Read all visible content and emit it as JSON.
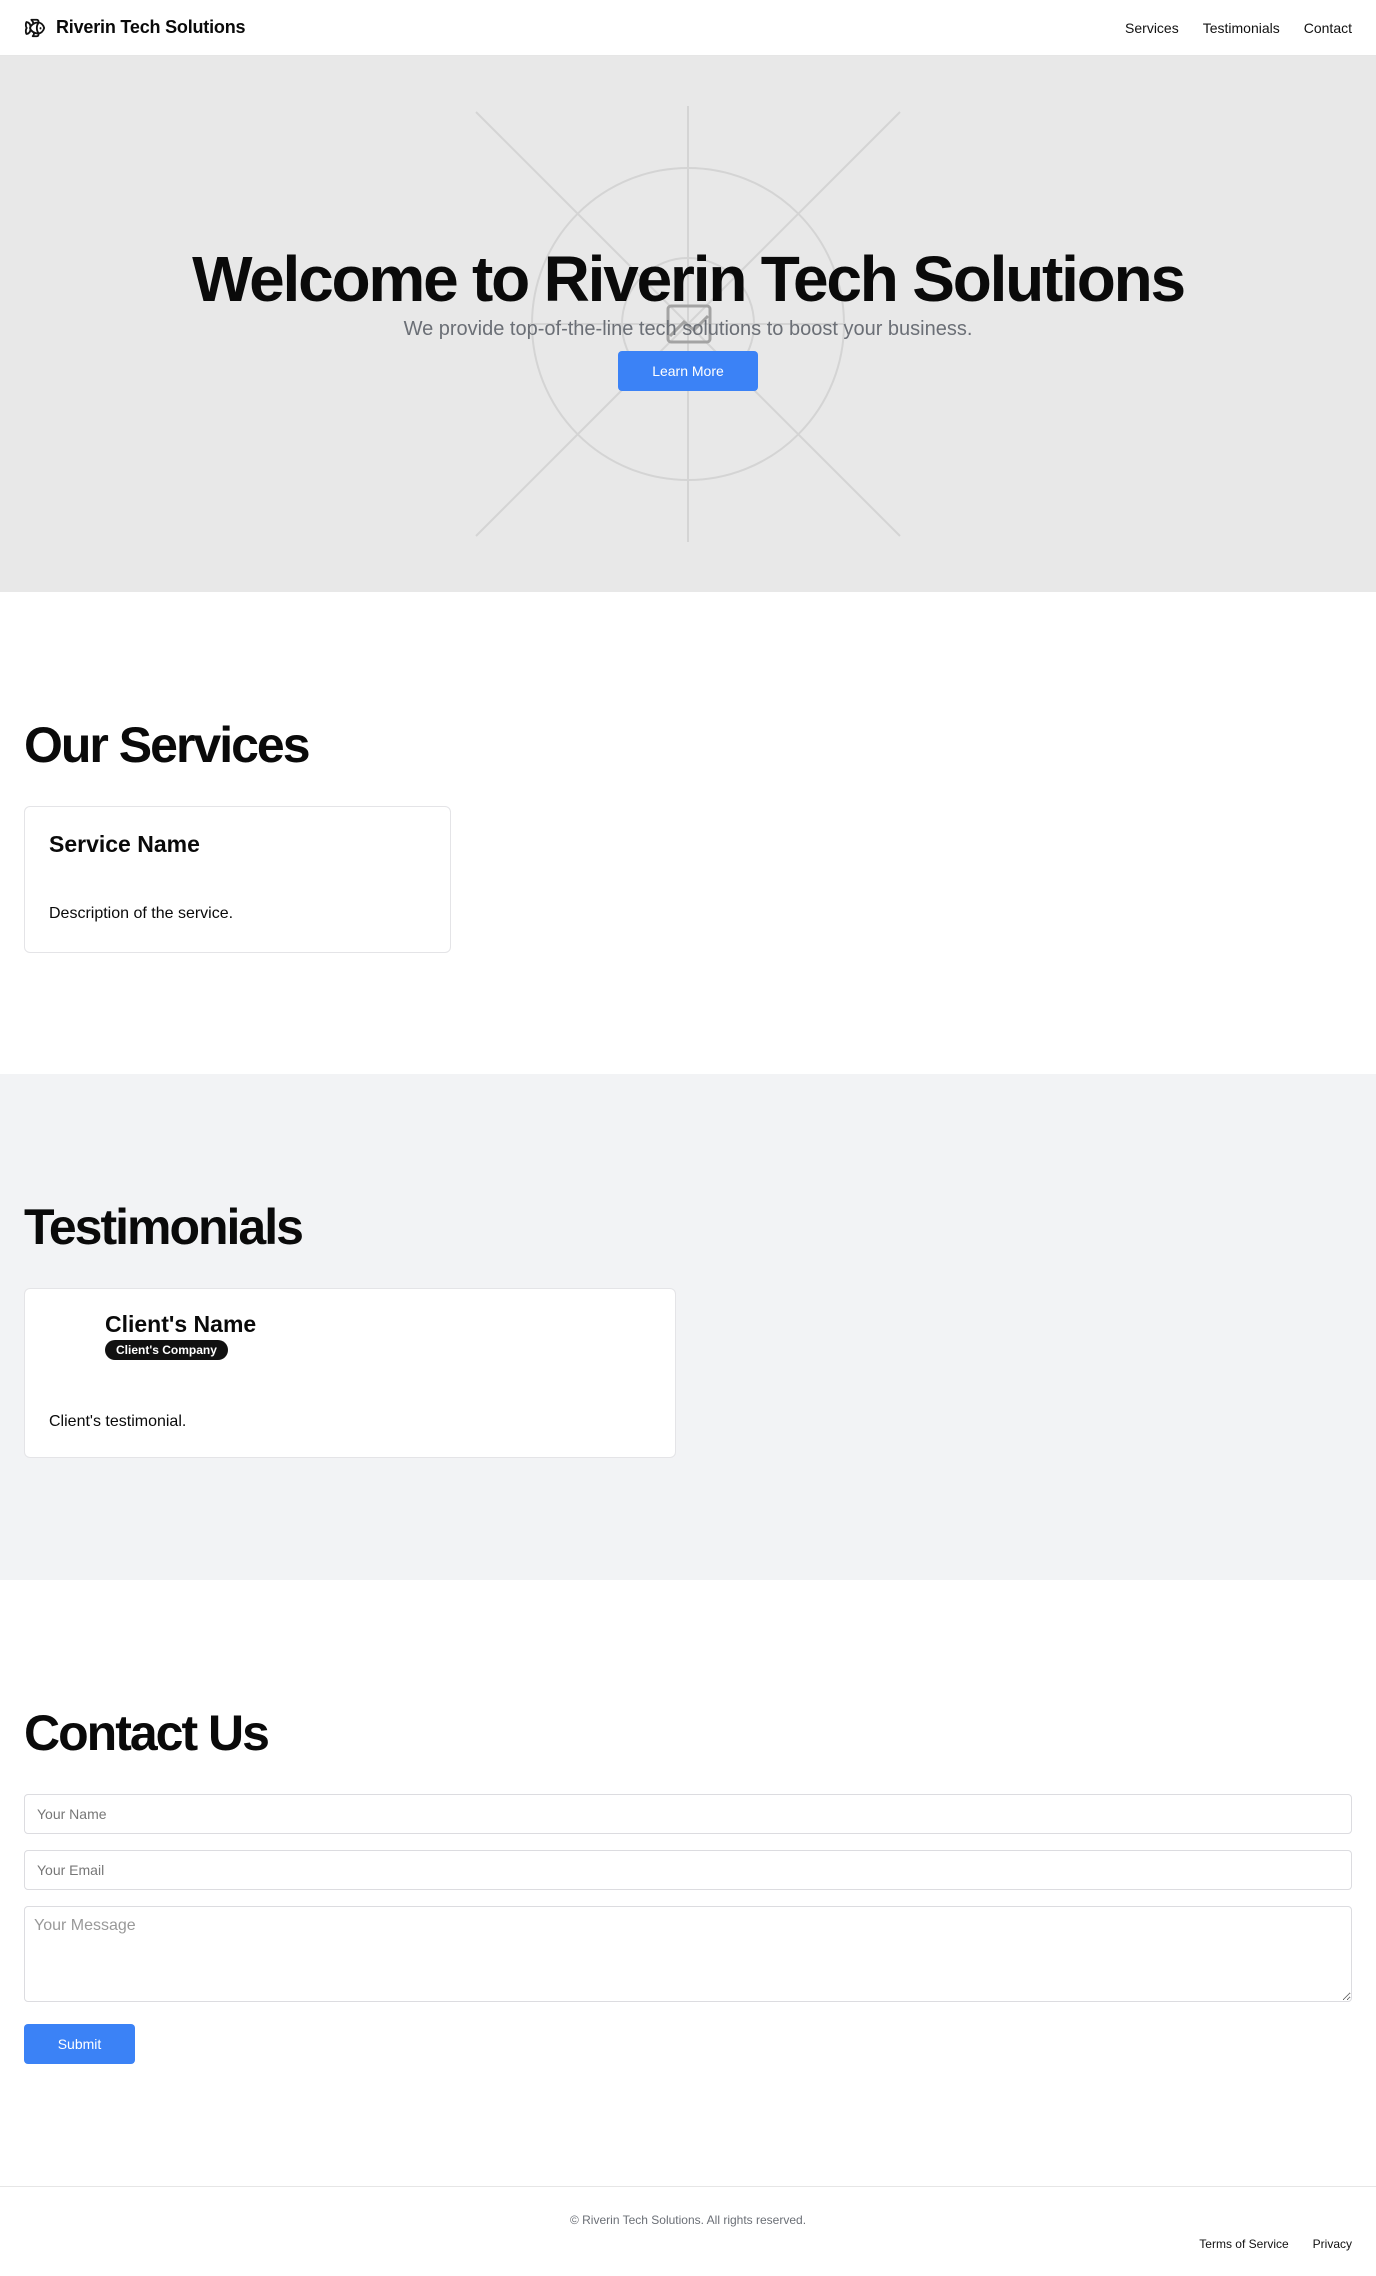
{
  "header": {
    "brand": "Riverin Tech Solutions",
    "logo_icon": "fish-logo-icon",
    "nav": [
      "Services",
      "Testimonials",
      "Contact"
    ]
  },
  "hero": {
    "title": "Welcome to Riverin Tech Solutions",
    "subtitle": "We provide top-of-the-line tech solutions to boost your business.",
    "button": "Learn More",
    "background_icon": "image-placeholder-icon"
  },
  "services": {
    "title": "Our Services",
    "items": [
      {
        "name": "Service Name",
        "description": "Description of the service."
      }
    ]
  },
  "testimonials": {
    "title": "Testimonials",
    "items": [
      {
        "client_name": "Client's Name",
        "company": "Client's Company",
        "quote": "Client's testimonial."
      }
    ]
  },
  "contact": {
    "title": "Contact Us",
    "name_placeholder": "Your Name",
    "email_placeholder": "Your Email",
    "message_placeholder": "Your Message",
    "submit": "Submit"
  },
  "footer": {
    "copyright": "© Riverin Tech Solutions. All rights reserved.",
    "links": [
      "Terms of Service",
      "Privacy"
    ]
  },
  "colors": {
    "accent": "#3b82f6",
    "hero_bg": "#e8e8e8",
    "testimonials_bg": "#f2f3f5",
    "badge_bg": "#111111"
  }
}
